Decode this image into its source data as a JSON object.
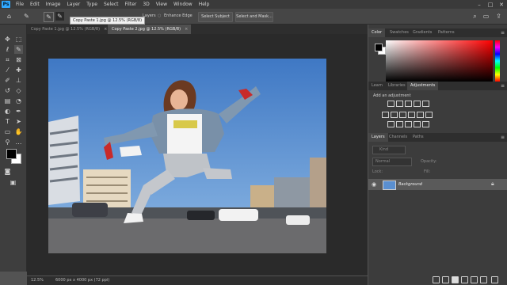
{
  "app": {
    "name": "Photoshop",
    "logo": "Ps"
  },
  "menubar": {
    "items": [
      "File",
      "Edit",
      "Image",
      "Layer",
      "Type",
      "Select",
      "Filter",
      "3D",
      "View",
      "Window",
      "Help"
    ]
  },
  "options": {
    "sample_all_layers_label": "Layers",
    "enhance_edge_label": "Enhance Edge",
    "select_subject_label": "Select Subject",
    "select_mask_label": "Select and Mask...",
    "tooltip": "Copy Paste 1.jpg @ 12.5% (RGB/8)"
  },
  "tabs": [
    {
      "label": "Copy Paste 1.jpg @ 12.5% (RGB/8)",
      "close": "×"
    },
    {
      "label": "Copy Paste 2.jpg @ 12.5% (RGB/8)",
      "close": "×"
    }
  ],
  "status": {
    "zoom": "12.5%",
    "doc_info": "6000 px x 4000 px (72 ppi)"
  },
  "panels": {
    "color_tabs": [
      "Color",
      "Swatches",
      "Gradients",
      "Patterns"
    ],
    "adjust_tabs": [
      "Learn",
      "Libraries",
      "Adjustments"
    ],
    "adjust_hint": "Add an adjustment",
    "layers_tabs": [
      "Layers",
      "Channels",
      "Paths"
    ],
    "kind_label": "Kind",
    "mode_label": "Normal",
    "opacity_label": "Opacity:",
    "lock_label": "Lock:",
    "fill_label": "Fill:",
    "layer_name": "Background"
  },
  "colors": {
    "accent": "#31a8ff",
    "foreground": "#000000",
    "background": "#ffffff"
  }
}
